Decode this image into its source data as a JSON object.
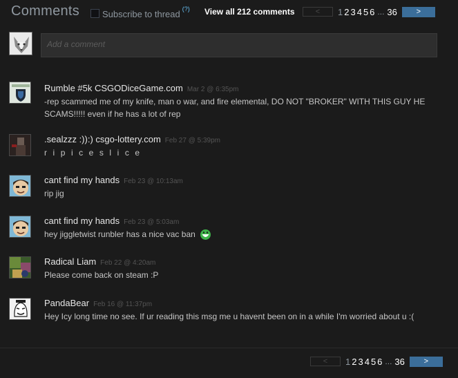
{
  "header": {
    "title": "Comments",
    "subscribe_label": "Subscribe to thread",
    "help_label": "(?)",
    "view_all": "View all 212 comments"
  },
  "pager": {
    "prev_label": "<",
    "next_label": ">",
    "pages": [
      "1",
      "2",
      "3",
      "4",
      "5",
      "6"
    ],
    "ellipsis": "...",
    "last_page": "36"
  },
  "compose": {
    "placeholder": "Add a comment"
  },
  "comments": [
    {
      "author": "Rumble #5k CSGODiceGame.com",
      "time": "Mar 2 @ 6:35pm",
      "text": "-rep scammed me of my knife, man o war, and fire elemental, DO NOT \"BROKER\" WITH THIS GUY HE SCAMS!!!!! even if he has a lot of rep",
      "avatar": "shield-badge-avatar"
    },
    {
      "author": ".sealzzz :)):) csgo-lottery.com",
      "time": "Feb 27 @ 5:39pm",
      "text": "r i p i c e s l i c e",
      "avatar": "dark-figure-avatar"
    },
    {
      "author": "cant find my hands",
      "time": "Feb 23 @ 10:13am",
      "text": "rip jig",
      "avatar": "cartoon-face-avatar"
    },
    {
      "author": "cant find my hands",
      "time": "Feb 23 @ 5:03am",
      "text": "hey jiggletwist runbler has a nice vac ban",
      "avatar": "cartoon-face-avatar",
      "emoticon": "green-laughing-emoticon"
    },
    {
      "author": "Radical Liam",
      "time": "Feb 22 @ 4:20am",
      "text": "Please come back on steam :P",
      "avatar": "colorful-scene-avatar"
    },
    {
      "author": "PandaBear",
      "time": "Feb 16 @ 11:37pm",
      "text": "Hey Icy long time no see. If ur reading this msg me u havent been on in a while I'm worried about u :(",
      "avatar": "meme-face-avatar"
    }
  ],
  "colors": {
    "background": "#1b1b1b",
    "accent_blue": "#3b6e9a",
    "link_blue": "#67c1f5",
    "timestamp": "#545454"
  }
}
